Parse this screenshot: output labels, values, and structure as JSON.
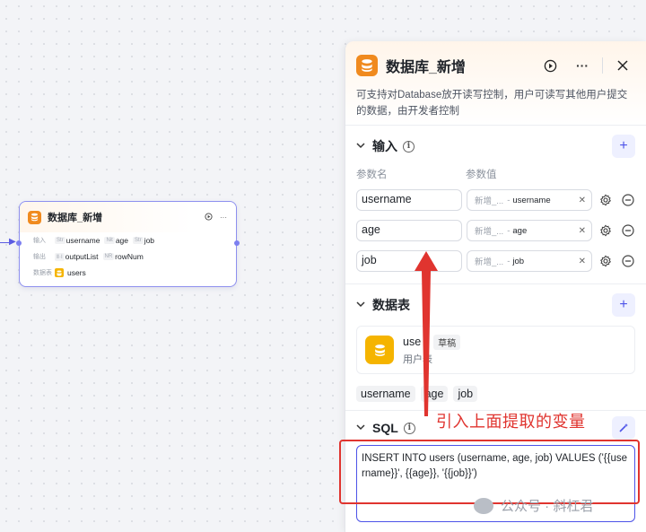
{
  "node": {
    "title": "数据库_新增",
    "input_label": "输入",
    "output_label": "输出",
    "table_label": "数据表",
    "inputs": [
      {
        "type": "Str",
        "name": "username"
      },
      {
        "type": "Nit",
        "name": "age"
      },
      {
        "type": "Str",
        "name": "job"
      }
    ],
    "outputs": [
      {
        "type": "Ⅱ·I",
        "name": "outputList"
      },
      {
        "type": "NR",
        "name": "rowNum"
      }
    ],
    "table": "users"
  },
  "panel": {
    "title": "数据库_新增",
    "description": "可支持对Database放开读写控制，用户可读写其他用户提交的数据，由开发者控制",
    "input_section": {
      "title": "输入",
      "col_name": "参数名",
      "col_value": "参数值",
      "params": [
        {
          "name": "username",
          "source": "新增_...",
          "var": "username"
        },
        {
          "name": "age",
          "source": "新增_...",
          "var": "age"
        },
        {
          "name": "job",
          "source": "新增_...",
          "var": "job"
        }
      ]
    },
    "table_section": {
      "title": "数据表",
      "table_name": "use",
      "draft": "草稿",
      "table_desc": "用户表",
      "fields": [
        "username",
        "age",
        "job"
      ]
    },
    "sql_section": {
      "title": "SQL",
      "sql": "INSERT INTO users (username, age, job) VALUES ('{{username}}', {{age}}, '{{job}}')"
    }
  },
  "annotation": {
    "text": "引入上面提取的变量",
    "color": "#e0342f"
  },
  "watermark": {
    "text": "公众号 · 斜杠君"
  },
  "colors": {
    "accent": "#4d53e8",
    "db_icon": "#f08a1e",
    "table_icon": "#f5b400"
  }
}
